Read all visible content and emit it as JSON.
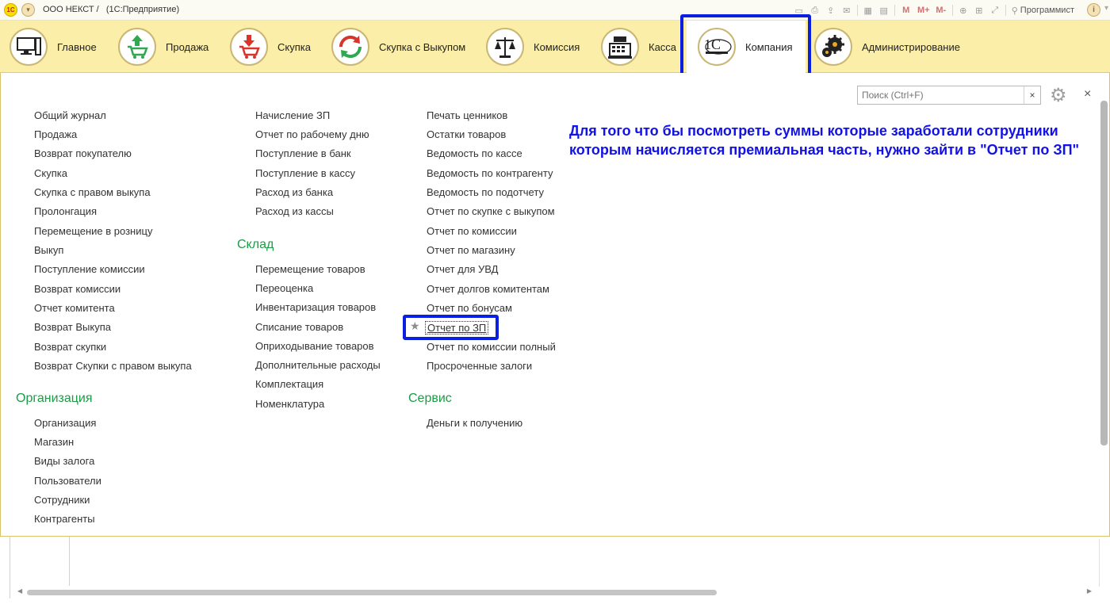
{
  "titlebar": {
    "logo": "1С",
    "title": "ООО НЕКСТ /   (1С:Предприятие)",
    "icons": [
      "save-icon",
      "print-icon",
      "upload-icon",
      "mail-icon",
      "table-icon",
      "calendar-icon"
    ],
    "m_buttons": [
      "M",
      "M+",
      "M-"
    ],
    "user": "Программист",
    "info": "i"
  },
  "sections": [
    {
      "label": "Главное",
      "icon": "computer-icon"
    },
    {
      "label": "Продажа",
      "icon": "cart-up-icon"
    },
    {
      "label": "Скупка",
      "icon": "cart-down-icon"
    },
    {
      "label": "Скупка с Выкупом",
      "icon": "recycle-icon"
    },
    {
      "label": "Комиссия",
      "icon": "scales-icon"
    },
    {
      "label": "Касса",
      "icon": "cash-register-icon"
    },
    {
      "label": "Компания",
      "icon": "company-logo-icon",
      "active": true
    },
    {
      "label": "Администрирование",
      "icon": "gears-icon"
    }
  ],
  "search": {
    "placeholder": "Поиск (Ctrl+F)",
    "clear": "×"
  },
  "close": "×",
  "note": "Для того что бы посмотреть суммы которые заработали сотрудники которым начисляется премиальная часть, нужно зайти в \"Отчет по ЗП\"",
  "col1": {
    "items": [
      "Общий журнал",
      "Продажа",
      "Возврат покупателю",
      "Скупка",
      "Скупка с правом выкупа",
      "Пролонгация",
      "Перемещение в розницу",
      "Выкуп",
      "Поступление комиссии",
      "Возврат комиссии",
      "Отчет комитента",
      "Возврат Выкупа",
      "Возврат скупки",
      "Возврат Скупки с правом выкупа"
    ],
    "group2": "Организация",
    "items2": [
      "Организация",
      "Магазин",
      "Виды залога",
      "Пользователи",
      "Сотрудники",
      "Контрагенты"
    ]
  },
  "col2": {
    "items": [
      "Начисление ЗП",
      "Отчет по рабочему дню",
      "Поступление в банк",
      "Поступление в кассу",
      "Расход из банка",
      "Расход из кассы"
    ],
    "group2": "Склад",
    "items2": [
      "Перемещение товаров",
      "Переоценка",
      "Инвентаризация товаров",
      "Списание товаров",
      "Оприходывание товаров",
      "Дополнительные расходы",
      "Комплектация",
      "Номенклатура"
    ]
  },
  "col3": {
    "items": [
      "Печать ценников",
      "Остатки товаров",
      "Ведомость по кассе",
      "Ведомость по контрагенту",
      "Ведомость по подотчету",
      "Отчет по скупке с выкупом",
      "Отчет по комиссии",
      "Отчет по магазину",
      "Отчет для УВД",
      "Отчет долгов комитентам",
      "Отчет по бонусам",
      "Отчет по ЗП",
      "Отчет по комиссии полный",
      "Просроченные залоги"
    ],
    "group2": "Сервис",
    "items2": [
      "Деньги к получению"
    ]
  },
  "colors": {
    "accent_box": "#0a1fe0",
    "group_green": "#1d9b46",
    "note_blue": "#1111e8",
    "section_bg": "#fbeea8"
  }
}
